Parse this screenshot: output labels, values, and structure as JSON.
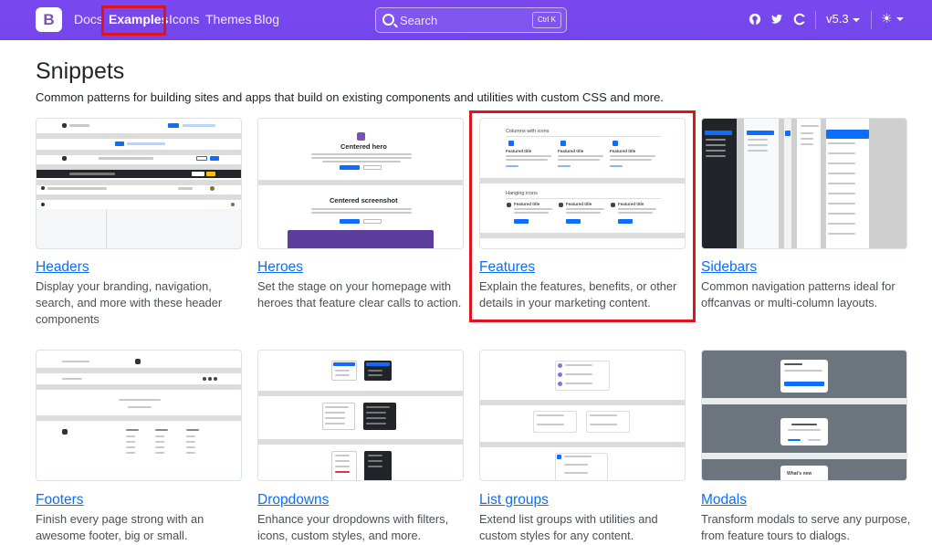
{
  "navbar": {
    "brand": "B",
    "links": [
      "Docs",
      "Examples",
      "Icons",
      "Themes",
      "Blog"
    ],
    "active": "Examples",
    "search_placeholder": "Search",
    "search_shortcut": "Ctrl K",
    "icons": [
      "github-icon",
      "twitter-icon",
      "opencollective-icon"
    ],
    "version": "v5.3",
    "theme_icon": "sun-icon"
  },
  "header": {
    "title": "Snippets",
    "lead": "Common patterns for building sites and apps that build on existing components and utilities with custom CSS and more."
  },
  "cards": [
    {
      "title": "Headers",
      "desc": "Display your branding, navigation, search, and more with these header components"
    },
    {
      "title": "Heroes",
      "desc": "Set the stage on your homepage with heroes that feature clear calls to action."
    },
    {
      "title": "Features",
      "desc": "Explain the features, benefits, or other details in your marketing content."
    },
    {
      "title": "Sidebars",
      "desc": "Common navigation patterns ideal for offcanvas or multi-column layouts."
    },
    {
      "title": "Footers",
      "desc": "Finish every page strong with an awesome footer, big or small."
    },
    {
      "title": "Dropdowns",
      "desc": "Enhance your dropdowns with filters, icons, custom styles, and more."
    },
    {
      "title": "List groups",
      "desc": "Extend list groups with utilities and custom styles for any content."
    },
    {
      "title": "Modals",
      "desc": "Transform modals to serve any purpose, from feature tours to dialogs."
    }
  ],
  "thumbnails": {
    "heroes": {
      "hero_title": "Centered hero",
      "screenshot_title": "Centered screenshot"
    },
    "features": {
      "heading1": "Columns with icons",
      "heading2": "Hanging icons",
      "feature_title": "Featured title"
    },
    "modals": {
      "modal_title": "What's new"
    }
  },
  "colors": {
    "navbar": "#7445ec",
    "link": "#0d6efd",
    "highlight": "#e0141c"
  }
}
